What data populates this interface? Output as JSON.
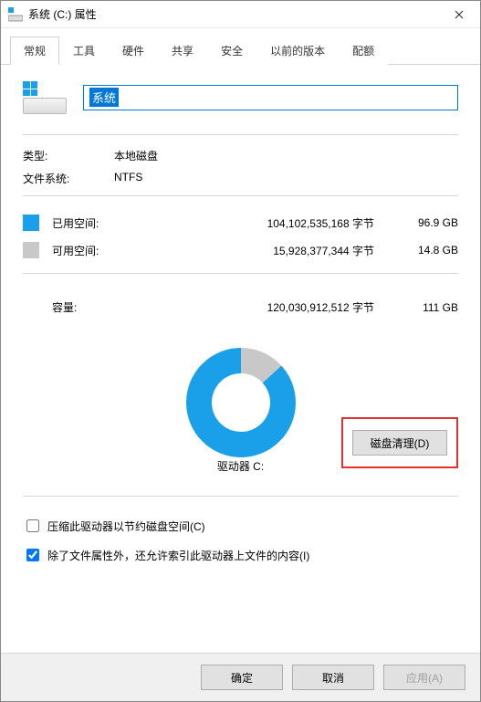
{
  "window": {
    "title": "系统 (C:) 属性"
  },
  "tabs": {
    "items": [
      "常规",
      "工具",
      "硬件",
      "共享",
      "安全",
      "以前的版本",
      "配额"
    ],
    "active_index": 0
  },
  "general": {
    "name_value": "系统",
    "type_label": "类型:",
    "type_value": "本地磁盘",
    "fs_label": "文件系统:",
    "fs_value": "NTFS",
    "used_label": "已用空间:",
    "used_bytes": "104,102,535,168 字节",
    "used_gb": "96.9 GB",
    "free_label": "可用空间:",
    "free_bytes": "15,928,377,344 字节",
    "free_gb": "14.8 GB",
    "capacity_label": "容量:",
    "capacity_bytes": "120,030,912,512 字节",
    "capacity_gb": "111 GB",
    "drive_caption": "驱动器 C:",
    "cleanup_button": "磁盘清理(D)",
    "compress_label": "压缩此驱动器以节约磁盘空间(C)",
    "compress_checked": false,
    "index_label": "除了文件属性外，还允许索引此驱动器上文件的内容(I)",
    "index_checked": true
  },
  "chart_data": {
    "type": "pie",
    "title": "驱动器 C:",
    "series": [
      {
        "name": "已用空间",
        "value": 96.9,
        "color": "#1aa0e8"
      },
      {
        "name": "可用空间",
        "value": 14.8,
        "color": "#c8c8c8"
      }
    ],
    "unit": "GB",
    "total": 111
  },
  "footer": {
    "ok": "确定",
    "cancel": "取消",
    "apply": "应用(A)"
  }
}
